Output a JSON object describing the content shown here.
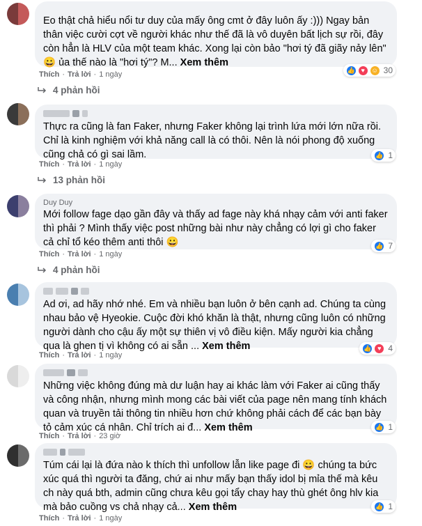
{
  "comments": [
    {
      "author": "",
      "text": "Eo thật chả hiểu nổi tư duy của mấy ông cmt ở đây luôn ấy :))) Ngay bản thân việc cười cợt về người khác như thế đã là vô duyên bất lịch sự rồi, đây còn hẳn là HLV của một team khác. Xong lại còn bảo \"hơi tý đã giãy nảy lên\" 😀 ủa thế nào là \"hơi tý\"? M...",
      "see_more": "Xem thêm",
      "like_label": "Thích",
      "reply_label": "Trả lời",
      "time": "1 ngày",
      "reactions": [
        "like",
        "love",
        "haha"
      ],
      "reaction_count": "30",
      "replies_label": "4 phản hồi"
    },
    {
      "author": "",
      "text": "Thực ra cũng là fan Faker, nhưng Faker không lại trình lứa mới lớn nữa rồi. Chỉ là kinh nghiệm với khả năng call là có thôi. Nên là nói phong độ xuống cũng chả có gì sai lầm.",
      "see_more": "",
      "like_label": "Thích",
      "reply_label": "Trả lời",
      "time": "1 ngày",
      "reactions": [
        "like"
      ],
      "reaction_count": "1",
      "replies_label": "13 phản hồi"
    },
    {
      "author": "Duy Duy",
      "text": "Mới follow fage dạo gần đây và thấy ad fage này khá nhạy cảm với anti faker thì phải ? Mình thấy việc post những bài như này chẳng có lợi gì cho faker cả chỉ tổ kéo thêm anti thôi 😀",
      "see_more": "",
      "like_label": "Thích",
      "reply_label": "Trả lời",
      "time": "1 ngày",
      "reactions": [
        "like"
      ],
      "reaction_count": "7",
      "replies_label": "4 phản hồi"
    },
    {
      "author": "",
      "text": "Ad ơi, ad hãy nhớ nhé. Em và nhiều bạn luôn ở bên cạnh ad. Chúng ta cùng nhau bảo vệ Hyeokie. Cuộc đời khó khăn là thật, nhưng cũng luôn có những người dành cho cậu ấy một sự thiên vị vô điều kiện. Mấy người kia chẳng qua là ghen tị vì không có ai sẵn ...",
      "see_more": "Xem thêm",
      "like_label": "Thích",
      "reply_label": "Trả lời",
      "time": "1 ngày",
      "reactions": [
        "like",
        "love"
      ],
      "reaction_count": "4",
      "replies_label": ""
    },
    {
      "author": "",
      "text": "Những việc không đúng mà dư luận hay ai khác làm với Faker ai cũng thấy và công nhận, nhưng mình mong các bài viết của page nên mang tính khách quan và truyền tải thông tin nhiều hơn chứ không phải cách để các bạn bày tỏ cảm xúc cá nhân. Chỉ trích ai đ...",
      "see_more": "Xem thêm",
      "like_label": "Thích",
      "reply_label": "Trả lời",
      "time": "23 giờ",
      "reactions": [
        "like"
      ],
      "reaction_count": "1",
      "replies_label": ""
    },
    {
      "author": "",
      "text": "Túm cái lại là đứa nào k thích thì unfollow lẫn like page đi 😀 chúng ta bức xúc quá thì người ta đăng, chứ ai như mấy bạn thấy idol bị mỉa thế mà kêu ch này quá bth, admin cũng chưa kêu gọi tẩy chay hay thù ghét ông hlv kia mà bảo cuồng vs chả nhạy cả...",
      "see_more": "Xem thêm",
      "like_label": "Thích",
      "reply_label": "Trả lời",
      "time": "1 ngày",
      "reactions": [
        "like"
      ],
      "reaction_count": "1",
      "replies_label": ""
    }
  ],
  "colors": {
    "bubble": "#f0f2f5",
    "meta": "#65676b",
    "like": "#1877f2",
    "love": "#f33e58",
    "haha": "#f7b125"
  }
}
